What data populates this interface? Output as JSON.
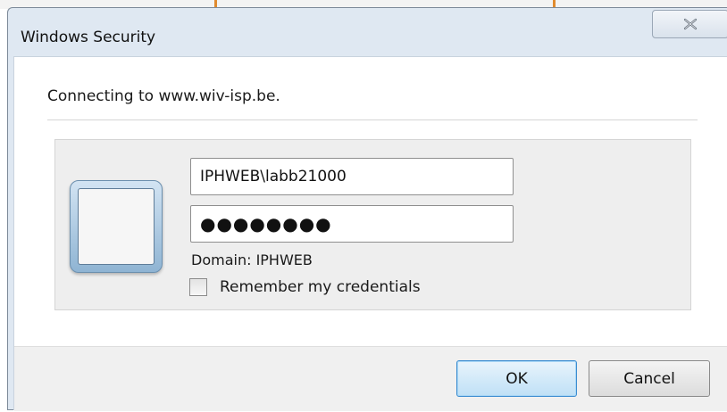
{
  "window": {
    "title": "Windows Security"
  },
  "prompt": {
    "text": "Connecting to www.wiv-isp.be."
  },
  "credentials": {
    "username": "IPHWEB\\labb21000",
    "password_mask": "●●●●●●●●",
    "domain_text": "Domain: IPHWEB",
    "remember_label": "Remember my credentials",
    "remember_checked": false
  },
  "buttons": {
    "ok": "OK",
    "cancel": "Cancel"
  },
  "icons": {
    "close": "close-icon",
    "user_tile": "user-tile-icon"
  },
  "colors": {
    "ok_border": "#3b8cd0",
    "window_frame": "#dfe8f2"
  }
}
